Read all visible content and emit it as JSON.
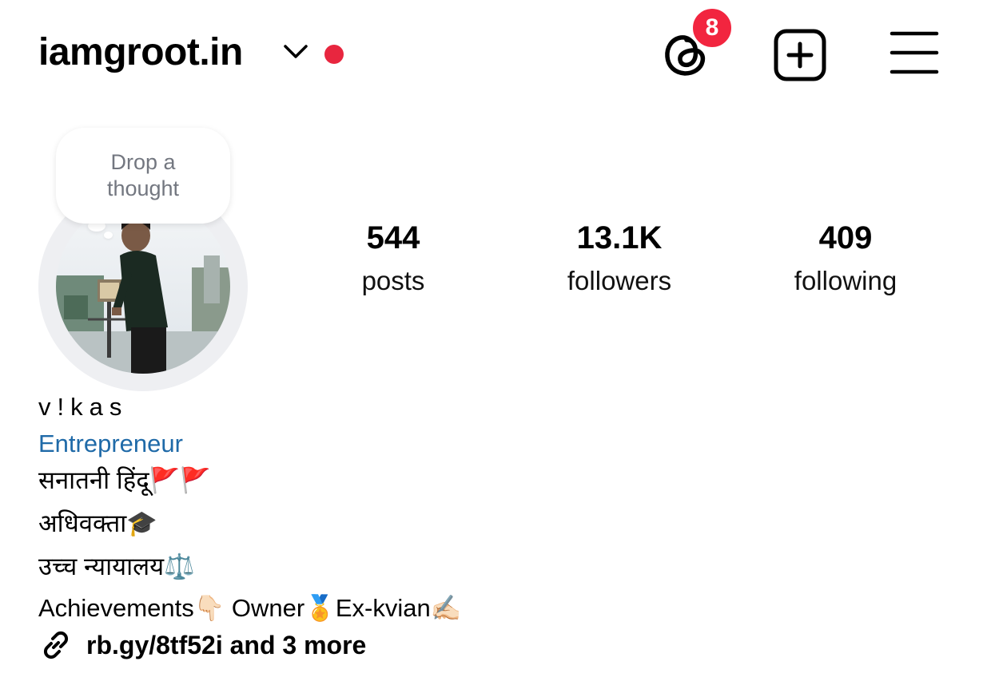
{
  "header": {
    "username": "iamgroot.in",
    "switch_account_icon": "chevron-down-icon",
    "live_dot_color": "#e8263f",
    "threads_icon": "threads-icon",
    "threads_badge_count": "8",
    "badge_color": "#f2253f",
    "new_post_icon": "plus-square-icon",
    "menu_icon": "hamburger-menu-icon"
  },
  "profile": {
    "note_text": "Drop a thought",
    "avatar_icon": "profile-photo",
    "stats": [
      {
        "value": "544",
        "label": "posts"
      },
      {
        "value": "13.1K",
        "label": "followers"
      },
      {
        "value": "409",
        "label": "following"
      }
    ]
  },
  "bio": {
    "name": "v!kas",
    "category": "Entrepreneur",
    "category_color": "#1f6aa8",
    "lines": [
      "सनातनी हिंदू🚩🚩",
      "अधिवक्ता🎓",
      "उच्च न्यायालय⚖️",
      "Achievements👇🏻 Owner🏅Ex-kvian✍🏻"
    ],
    "link_icon": "link-icon",
    "link_text": "rb.gy/8tf52i and 3 more"
  }
}
